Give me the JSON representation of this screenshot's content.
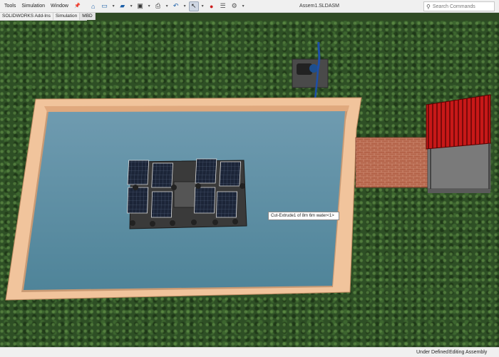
{
  "menu": {
    "items": [
      "Tools",
      "Simulation",
      "Window"
    ]
  },
  "toolbar": {
    "buttons": [
      "home-icon",
      "new-document-icon",
      "open-folder-icon",
      "save-icon",
      "print-icon",
      "undo-icon",
      "select-arrow-icon",
      "traffic-light-icon",
      "file-properties-icon",
      "gear-icon"
    ]
  },
  "window": {
    "title": "Assem1.SLDASM"
  },
  "search": {
    "placeholder": "Search Commands"
  },
  "command_tabs": [
    "SOLIDWORKS Add-Ins",
    "Simulation",
    "MBD"
  ],
  "tooltip": {
    "text": "Cut-Extrude1 of 8m 6m water<1>"
  },
  "status": {
    "left": "Under Defined",
    "right": "Editing Assembly"
  }
}
